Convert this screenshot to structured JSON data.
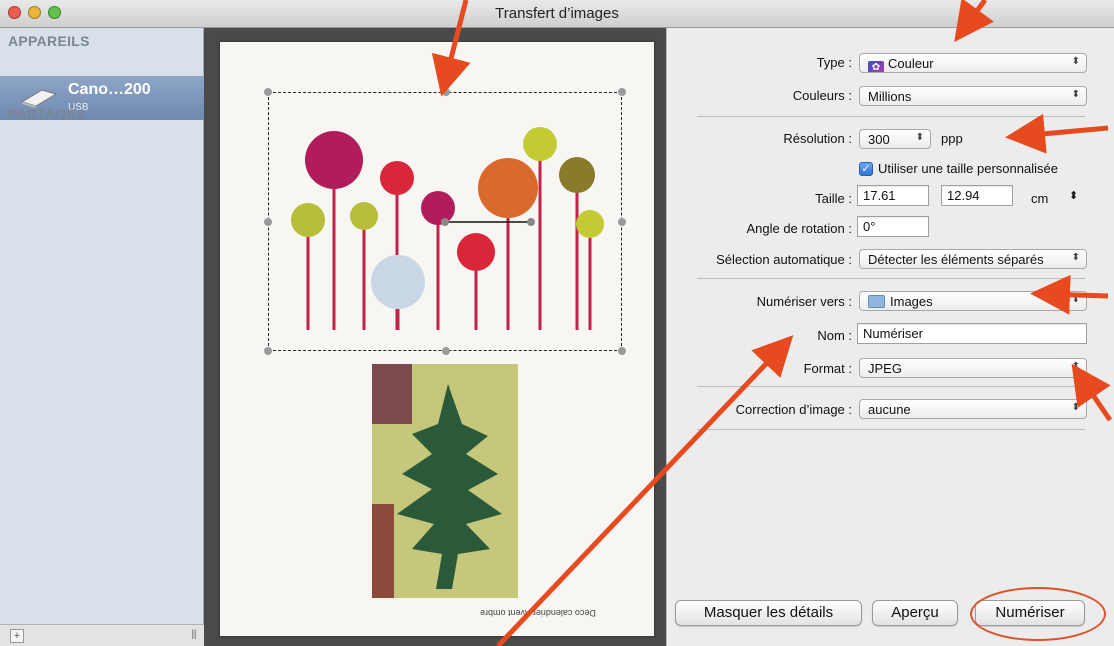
{
  "window": {
    "title": "Transfert d’images"
  },
  "sidebar": {
    "devices_heading": "APPAREILS",
    "device": {
      "name": "Cano…200",
      "subtitle": "USB"
    },
    "shared_heading": "PARTAGÉS",
    "add_button": "+",
    "grip": "|||"
  },
  "preview": {
    "caption": "Deco calendrier Avent ombre"
  },
  "settings": {
    "type": {
      "label": "Type :",
      "value": "Couleur"
    },
    "colors": {
      "label": "Couleurs :",
      "value": "Millions"
    },
    "resolution": {
      "label": "Résolution :",
      "value": "300",
      "unit": "ppp"
    },
    "custom_size": {
      "label": "Utiliser une taille personnalisée",
      "checked": true
    },
    "size": {
      "label": "Taille :",
      "width": "17.61",
      "height": "12.94",
      "unit": "cm"
    },
    "rotation": {
      "label": "Angle de rotation :",
      "value": "0°"
    },
    "auto_selection": {
      "label": "Sélection automatique :",
      "value": "Détecter les éléments séparés"
    },
    "scan_to": {
      "label": "Numériser vers :",
      "value": "Images"
    },
    "name": {
      "label": "Nom :",
      "value": "Numériser"
    },
    "format": {
      "label": "Format :",
      "value": "JPEG"
    },
    "image_correction": {
      "label": "Correction d’image :",
      "value": "aucune"
    }
  },
  "buttons": {
    "hide_details": "Masquer les détails",
    "preview": "Aperçu",
    "scan": "Numériser"
  },
  "colors": {
    "annotation": "#e64a1e",
    "traffic_red": "#ee5b52",
    "traffic_yellow": "#e9b53b",
    "traffic_green": "#5fc24b"
  }
}
